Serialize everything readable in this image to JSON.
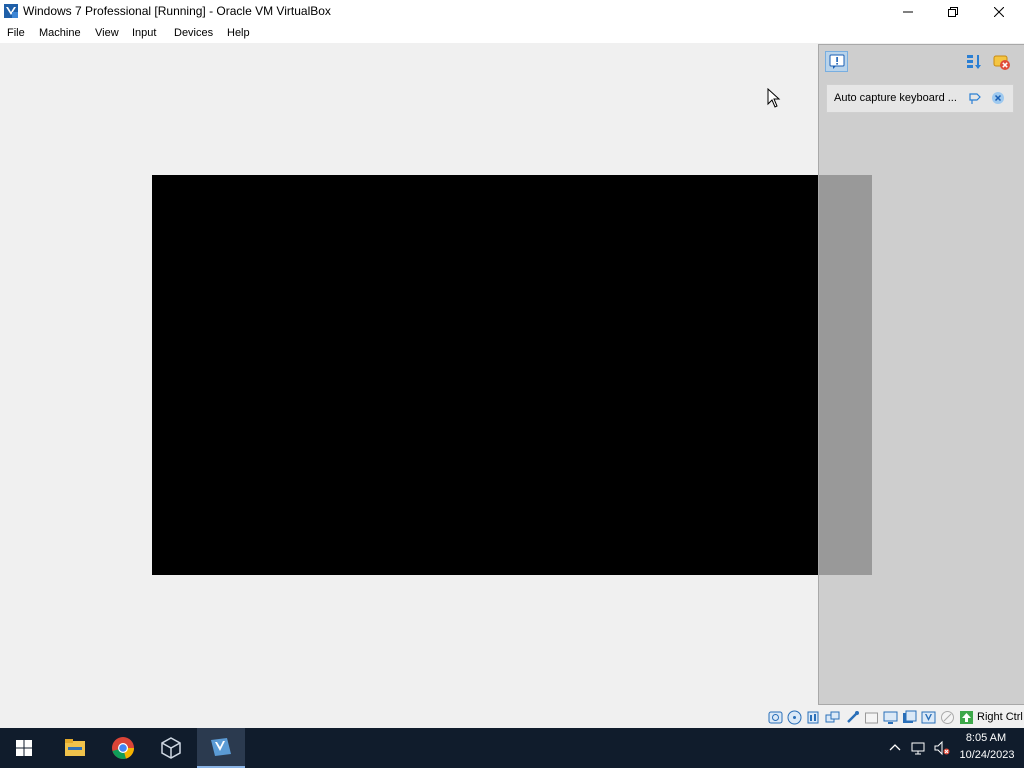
{
  "window": {
    "title": "Windows 7 Professional [Running] - Oracle VM VirtualBox",
    "app_icon": "virtualbox-vm-icon",
    "controls": [
      "minimize-icon",
      "maximize-icon",
      "close-icon"
    ]
  },
  "menu": {
    "items": [
      {
        "label": "File"
      },
      {
        "label": "Machine"
      },
      {
        "label": "View"
      },
      {
        "label": "Input"
      },
      {
        "label": "Devices"
      },
      {
        "label": "Help"
      }
    ]
  },
  "notification_center": {
    "toggle_icon": "notification-center-icon",
    "sort_icon": "sort-icon",
    "dismiss_all_icon": "dismiss-all-icon",
    "items": [
      {
        "text": "Auto capture keyboard ...",
        "pin_icon": "pin-icon",
        "close_icon": "close-icon"
      }
    ]
  },
  "statusbar": {
    "icons": [
      "hard-disk-icon",
      "optical-drive-icon",
      "audio-icon",
      "network-icon",
      "usb-icon",
      "shared-folders-icon",
      "display-icon",
      "recording-icon",
      "vm-activity-icon",
      "mouse-integration-icon",
      "keyboard-capture-icon"
    ],
    "host_key": "Right Ctrl"
  },
  "taskbar": {
    "apps": [
      "start-icon",
      "file-explorer-icon",
      "chrome-icon",
      "virtualbox-manager-icon",
      "virtualbox-vm-icon"
    ],
    "tray_icons": [
      "show-hidden-icons-icon",
      "network-icon",
      "volume-muted-icon"
    ],
    "time": "8:05 AM",
    "date": "10/24/2023"
  },
  "colors": {
    "taskbar": "#101c2c",
    "guest_screen": "#000000",
    "notification_panel": "#c4c4c4",
    "active_toggle": "#b9d3ea"
  }
}
